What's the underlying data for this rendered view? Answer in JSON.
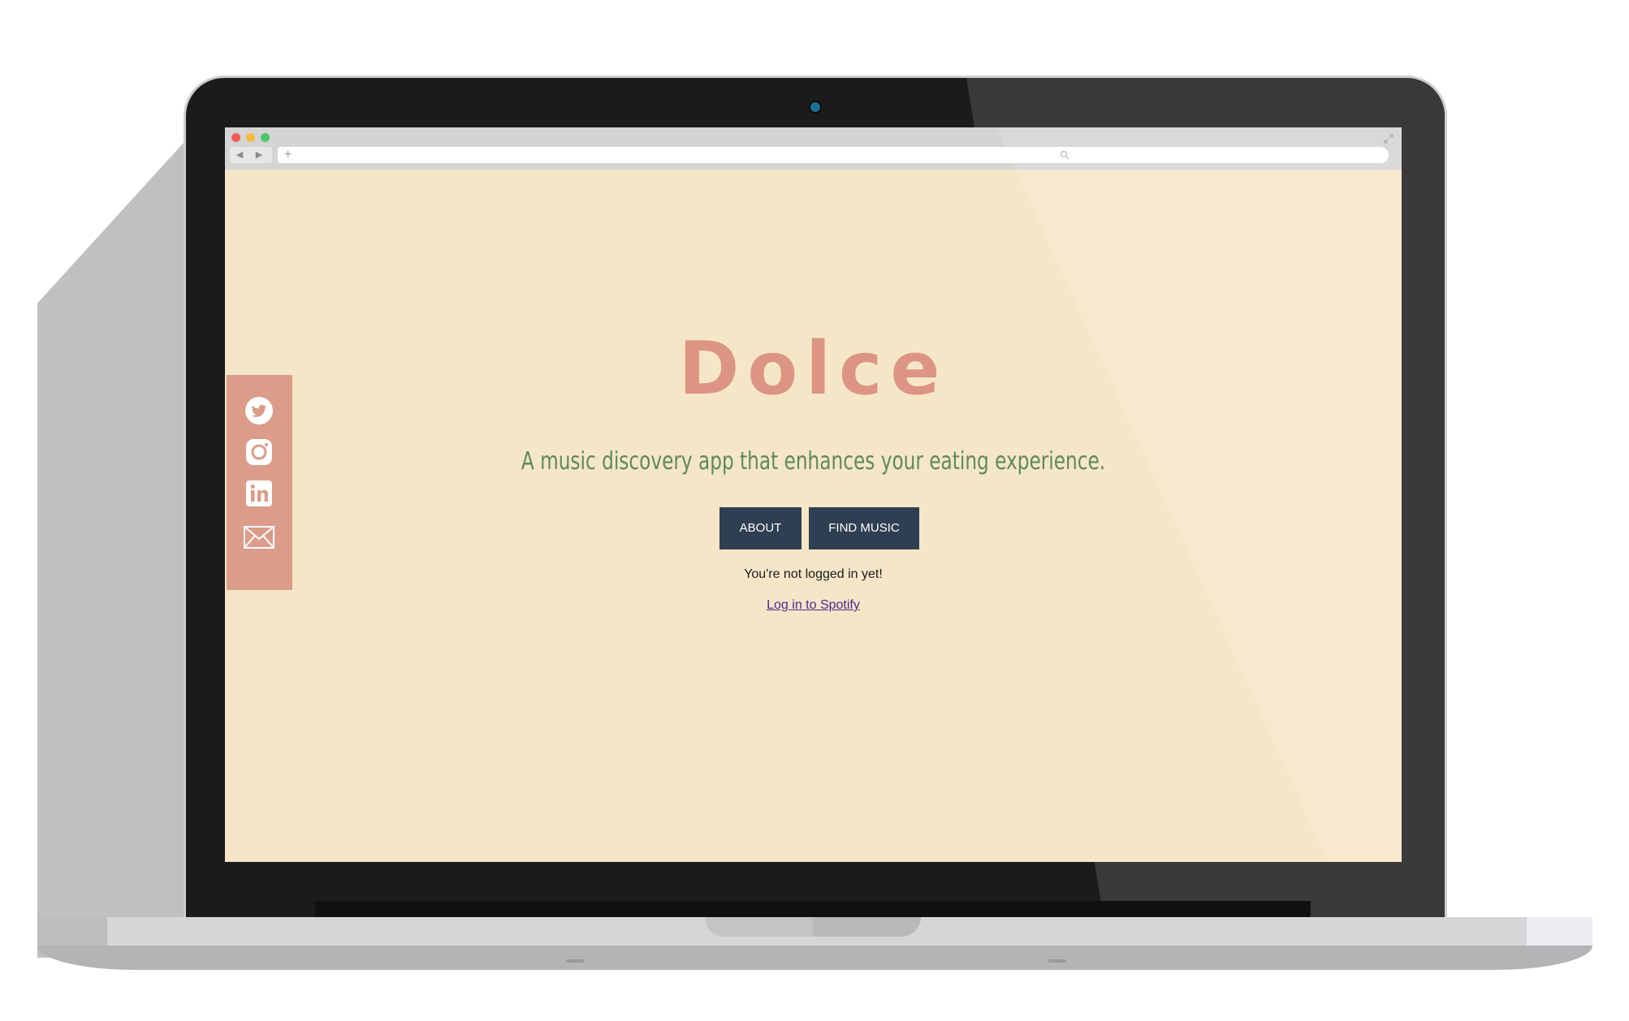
{
  "browser": {
    "back_glyph": "◀",
    "forward_glyph": "▶",
    "new_tab_glyph": "+",
    "window_controls": [
      "close",
      "minimize",
      "maximize"
    ],
    "window_control_colors": [
      "#f25a5a",
      "#f5bd3c",
      "#4cc76d"
    ]
  },
  "social": {
    "items": [
      {
        "name": "twitter-icon"
      },
      {
        "name": "instagram-icon"
      },
      {
        "name": "linkedin-icon"
      },
      {
        "name": "mail-icon"
      }
    ],
    "background": "#dc9c8a"
  },
  "hero": {
    "title": "Dolce",
    "subtitle": "A music discovery app that enhances your eating experience."
  },
  "buttons": {
    "about": "ABOUT",
    "find_music": "FIND MUSIC"
  },
  "auth": {
    "status": "You're not logged in yet!",
    "login_link": "Log in to Spotify"
  },
  "colors": {
    "page_background": "#f6e6c8",
    "title": "#dc9582",
    "subtitle": "#5e8a58",
    "button": "#2e3f52",
    "link": "#4a2a8c"
  }
}
